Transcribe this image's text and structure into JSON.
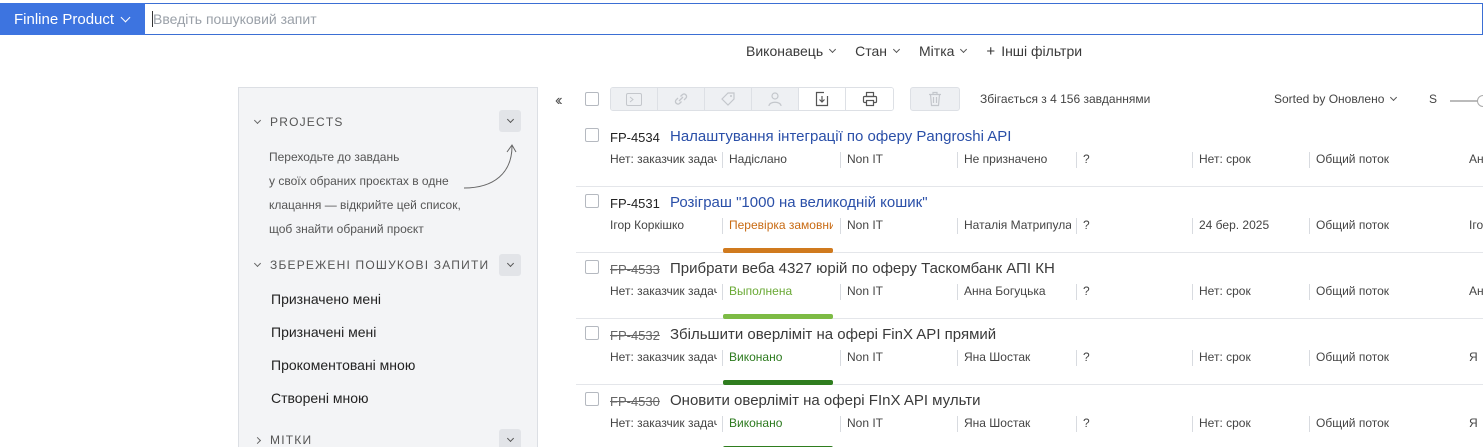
{
  "topbar": {
    "project_label": "Finline Product",
    "search_placeholder": "Введіть пошуковий запит"
  },
  "filters": {
    "assignee": "Виконавець",
    "state": "Стан",
    "label": "Мітка",
    "other": "Інші фільтри"
  },
  "sidebar": {
    "projects_header": "PROJECTS",
    "projects_hint": [
      "Переходьте до завдань",
      "у своїх обраних проєктах в одне",
      "клацання — відкрийте цей список,",
      "щоб знайти обраний проєкт"
    ],
    "saved_header": "ЗБЕРЕЖЕНІ ПОШУКОВІ ЗАПИТИ",
    "saved_items": [
      "Призначено мені",
      "Призначені мені",
      "Прокоментовані мною",
      "Створені мною"
    ],
    "tags_header": "МІТКИ"
  },
  "toolbar": {
    "match_count": "Збігається з 4 156 завданнями",
    "sort_label": "Sorted by Оновлено",
    "size_label": "S"
  },
  "tasks": [
    {
      "key": "FP-4534",
      "resolved": false,
      "title": "Налаштування інтеграції по оферу Pangroshi API",
      "reporter": "Нет: заказчик задачи",
      "state": "Надіслано",
      "state_color": "#444444",
      "bar_color": "",
      "type": "Non IT",
      "assignee": "Не призначено",
      "priority": "?",
      "due": "Нет: срок",
      "flow": "Общий поток",
      "extra": "Ан"
    },
    {
      "key": "FP-4531",
      "resolved": false,
      "title": "Розіграш \"1000 на великодній кошик\"",
      "reporter": "Ігор Коркішко",
      "state": "Перевірка замовником",
      "state_color": "#c86a12",
      "bar_color": "#d07a1e",
      "type": "Non IT",
      "assignee": "Наталія Матрипула",
      "priority": "?",
      "due": "24 бер. 2025",
      "flow": "Общий поток",
      "extra": "Ігор"
    },
    {
      "key": "FP-4533",
      "resolved": true,
      "title": "Прибрати веба 4327 юрій по оферу Таскомбанк АПІ КН",
      "reporter": "Нет: заказчик задачи",
      "state": "Выполнена",
      "state_color": "#6aa935",
      "bar_color": "#7dbb45",
      "type": "Non IT",
      "assignee": "Анна Богуцька",
      "priority": "?",
      "due": "Нет: срок",
      "flow": "Общий поток",
      "extra": "Анн"
    },
    {
      "key": "FP-4532",
      "resolved": true,
      "title": "Збільшити оверліміт на офері FinX API прямий",
      "reporter": "Нет: заказчик задачи",
      "state": "Виконано",
      "state_color": "#2c7a1e",
      "bar_color": "#2f7d1f",
      "type": "Non IT",
      "assignee": "Яна Шостак",
      "priority": "?",
      "due": "Нет: срок",
      "flow": "Общий поток",
      "extra": "Я"
    },
    {
      "key": "FP-4530",
      "resolved": true,
      "title": "Оновити оверліміт на офері FInX API мульти",
      "reporter": "Нет: заказчик задачи",
      "state": "Виконано",
      "state_color": "#2c7a1e",
      "bar_color": "#2f7d1f",
      "type": "Non IT",
      "assignee": "Яна Шостак",
      "priority": "?",
      "due": "Нет: срок",
      "flow": "Общий поток",
      "extra": "Я"
    }
  ]
}
